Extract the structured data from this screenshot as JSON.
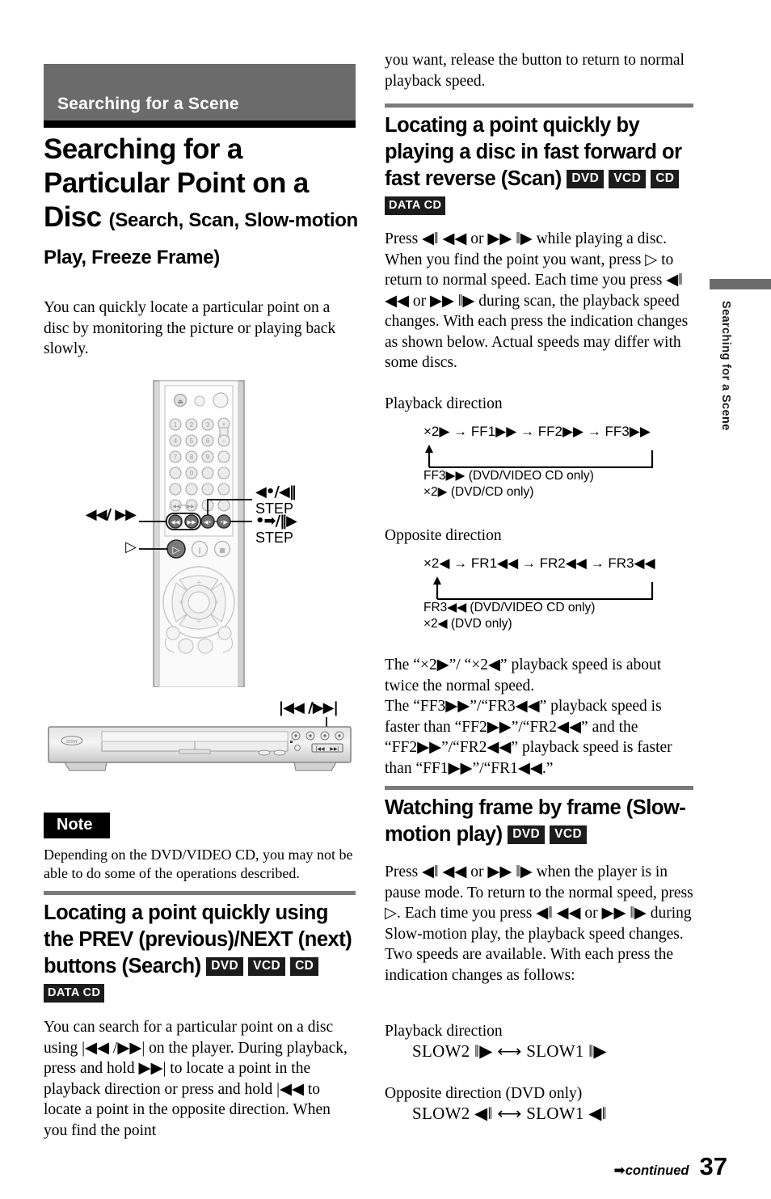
{
  "page": {
    "number": "37",
    "continued_label": "continued",
    "continued_arrow": "➡"
  },
  "chapter_banner": {
    "title": "Searching for a Scene"
  },
  "side_tab": {
    "label": "Searching for a Scene"
  },
  "main_title": {
    "line1": "Searching for a",
    "line2": "Particular Point on a",
    "line3": "Disc",
    "subtitle": "(Search, Scan, Slow-motion Play, Freeze Frame)"
  },
  "intro": {
    "text": "You can quickly locate a particular point on a disc by monitoring the picture or playing back slowly."
  },
  "remote_callouts": {
    "prev_next": "◀◀/ ▶▶",
    "step_back": "◀•/◀‖",
    "step_back_label": "STEP",
    "step_fwd": "•➡/‖▶",
    "step_fwd_label": "STEP",
    "play": "▷"
  },
  "player_callout": {
    "label": "|◀◀ /▶▶|"
  },
  "note": {
    "label": "Note",
    "text": "Depending on the DVD/VIDEO CD, you may not be able to do some of the operations described."
  },
  "sections": [
    {
      "id": "search",
      "heading": "Locating a point quickly using the PREV (previous)/NEXT (next) buttons (Search)",
      "badges": [
        "DVD",
        "VCD",
        "CD"
      ],
      "badges2": [
        "DATA CD"
      ],
      "body": "You can search for a particular point on a disc using |◀◀ /▶▶| on the player. During playback, press and hold ▶▶| to locate a point in the playback direction or press and hold |◀◀ to locate a point in the opposite direction. When you find the point"
    },
    {
      "id": "scan",
      "heading": "Locating a point quickly by playing a disc in fast forward or fast reverse (Scan)",
      "badges": [
        "DVD",
        "VCD",
        "CD"
      ],
      "badges2": [
        "DATA CD"
      ],
      "body": "Press ◀‖ ◀◀ or ▶▶ ‖▶ while playing a disc. When you find the point you want, press ▷ to return to normal speed. Each time you press ◀‖ ◀◀ or ▶▶ ‖▶ during scan, the playback speed changes. With each press the indication changes as shown below. Actual speeds may differ with some discs."
    },
    {
      "id": "slow",
      "heading": "Watching frame by frame (Slow-motion play)",
      "badges": [
        "DVD",
        "VCD"
      ],
      "body": "Press ◀‖ ◀◀ or ▶▶ ‖▶ when the player is in pause mode. To return to the normal speed, press ▷. Each time you press ◀‖ ◀◀ or ▶▶ ‖▶ during Slow-motion play, the playback speed changes. Two speeds are available. With each press the indication changes as follows:"
    }
  ],
  "right_continuation": {
    "text": "you want, release the button to return to normal playback speed."
  },
  "scan_diagrams": {
    "playback_label": "Playback direction",
    "playback_sequence": "×2▶ → FF1▶▶ → FF2▶▶ → FF3▶▶",
    "playback_notes": [
      "FF3▶▶ (DVD/VIDEO CD only)",
      "×2▶ (DVD/CD only)"
    ],
    "opposite_label": "Opposite direction",
    "opposite_sequence": "×2◀ → FR1◀◀ → FR2◀◀ → FR3◀◀",
    "opposite_notes": [
      "FR3◀◀ (DVD/VIDEO CD only)",
      "×2◀ (DVD only)"
    ]
  },
  "speed_explain": {
    "text": "The “×2▶”/ “×2◀” playback speed is about twice the normal speed.\nThe “FF3▶▶”/“FR3◀◀” playback speed is faster than “FF2▶▶”/“FR2◀◀” and the “FF2▶▶”/“FR2◀◀” playback speed is faster than “FF1▶▶”/“FR1◀◀.”"
  },
  "slow_diagrams": {
    "playback_label": "Playback direction",
    "playback_sequence": "SLOW2 ‖▶  ⟷  SLOW1 ‖▶",
    "opposite_label": "Opposite direction (DVD only)",
    "opposite_sequence": "SLOW2 ◀‖  ⟷  SLOW1 ◀‖"
  },
  "colors": {
    "banner_gray": "#6b6b6b",
    "rule_gray": "#7a7a7a",
    "badge_black": "#1c1c1c"
  }
}
